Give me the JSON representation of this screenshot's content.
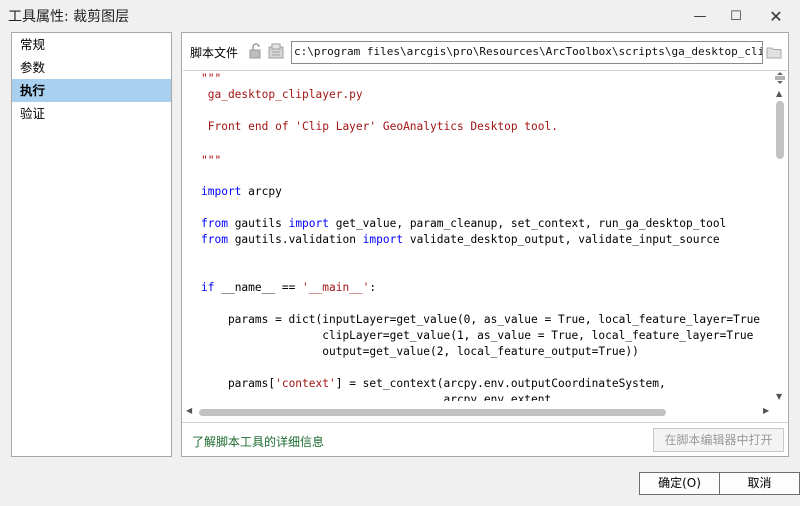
{
  "window": {
    "title": "工具属性: 裁剪图层",
    "minimize_glyph": "—",
    "maximize_glyph": "☐",
    "close_glyph": "✕"
  },
  "nav": {
    "items": [
      {
        "label": "常规",
        "selected": false
      },
      {
        "label": "参数",
        "selected": false
      },
      {
        "label": "执行",
        "selected": true
      },
      {
        "label": "验证",
        "selected": false
      }
    ]
  },
  "script": {
    "label": "脚本文件",
    "path": "c:\\program files\\arcgis\\pro\\Resources\\ArcToolbox\\scripts\\ga_desktop_cliplayer.py",
    "lines": [
      [
        {
          "t": "\"\"\"",
          "c": "str"
        }
      ],
      [
        {
          "t": " ga_desktop_cliplayer.py",
          "c": "str"
        }
      ],
      [
        {
          "t": "",
          "c": "tx"
        }
      ],
      [
        {
          "t": " Front end of 'Clip Layer' GeoAnalytics Desktop tool.",
          "c": "str"
        }
      ],
      [
        {
          "t": "",
          "c": "tx"
        }
      ],
      [
        {
          "t": "\"\"\"",
          "c": "str"
        }
      ],
      [
        {
          "t": "",
          "c": "tx"
        }
      ],
      [
        {
          "t": "import",
          "c": "kw"
        },
        {
          "t": " arcpy",
          "c": "tx"
        }
      ],
      [
        {
          "t": "",
          "c": "tx"
        }
      ],
      [
        {
          "t": "from",
          "c": "kw"
        },
        {
          "t": " gautils ",
          "c": "tx"
        },
        {
          "t": "import",
          "c": "kw"
        },
        {
          "t": " get_value, param_cleanup, set_context, run_ga_desktop_tool",
          "c": "tx"
        }
      ],
      [
        {
          "t": "from",
          "c": "kw"
        },
        {
          "t": " gautils.validation ",
          "c": "tx"
        },
        {
          "t": "import",
          "c": "kw"
        },
        {
          "t": " validate_desktop_output, validate_input_source",
          "c": "tx"
        }
      ],
      [
        {
          "t": "",
          "c": "tx"
        }
      ],
      [
        {
          "t": "",
          "c": "tx"
        }
      ],
      [
        {
          "t": "if",
          "c": "kw"
        },
        {
          "t": " __name__ == ",
          "c": "tx"
        },
        {
          "t": "'__main__'",
          "c": "str"
        },
        {
          "t": ":",
          "c": "tx"
        }
      ],
      [
        {
          "t": "",
          "c": "tx"
        }
      ],
      [
        {
          "t": "    params = dict(inputLayer=get_value(0, as_value = True, local_feature_layer=True",
          "c": "tx"
        }
      ],
      [
        {
          "t": "                  clipLayer=get_value(1, as_value = True, local_feature_layer=True",
          "c": "tx"
        }
      ],
      [
        {
          "t": "                  output=get_value(2, local_feature_output=True))",
          "c": "tx"
        }
      ],
      [
        {
          "t": "",
          "c": "tx"
        }
      ],
      [
        {
          "t": "    params[",
          "c": "tx"
        },
        {
          "t": "'context'",
          "c": "str"
        },
        {
          "t": "] = set_context(arcpy.env.outputCoordinateSystem,",
          "c": "tx"
        }
      ],
      [
        {
          "t": "                                    arcpy.env.extent,",
          "c": "tx"
        }
      ]
    ]
  },
  "footer": {
    "learn_more": "了解脚本工具的详细信息",
    "open_in_editor": "在脚本编辑器中打开",
    "ok": "确定(O)",
    "cancel": "取消"
  }
}
